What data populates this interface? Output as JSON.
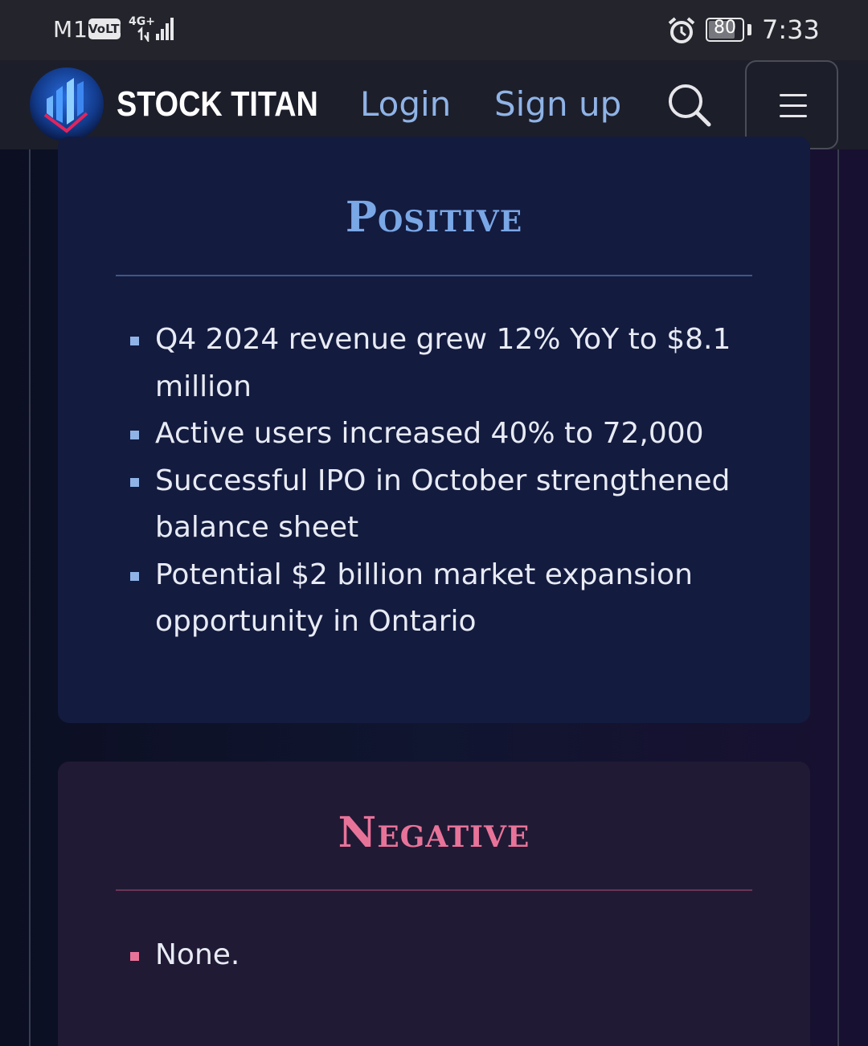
{
  "status_bar": {
    "carrier": "M1",
    "volte": "VoLTE",
    "network": "4G+",
    "battery": "80",
    "battery_level": 0.8,
    "time": "7:33",
    "icons": [
      "signal-icon",
      "alarm-icon",
      "battery-icon"
    ]
  },
  "header": {
    "brand": "STOCK TITAN",
    "login": "Login",
    "signup": "Sign up",
    "icons": [
      "stock-titan-logo-icon",
      "search-icon",
      "hamburger-menu-icon"
    ]
  },
  "positive": {
    "title": "Positive",
    "items": [
      "Q4 2024 revenue grew 12% YoY to $8.1 million",
      "Active users increased 40% to 72,000",
      "Successful IPO in October strengthened balance sheet",
      "Potential $2 billion market expansion opportunity in Ontario"
    ]
  },
  "negative": {
    "title": "Negative",
    "items": [
      "None."
    ]
  },
  "colors": {
    "status_bar_bg": "#23242c",
    "header_bg": "#1c1e2a",
    "positive_accent": "#7aa7e6",
    "negative_accent": "#e87399",
    "positive_card_bg": "#131b3f",
    "negative_card_bg": "#201a35",
    "link": "#8fb3e6"
  }
}
